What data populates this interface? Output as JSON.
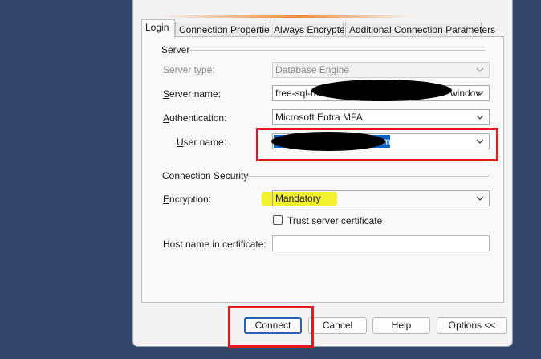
{
  "tabs": [
    {
      "label": "Login",
      "active": true
    },
    {
      "label": "Connection Properties",
      "active": false
    },
    {
      "label": "Always Encrypted",
      "active": false
    },
    {
      "label": "Additional Connection Parameters",
      "active": false
    }
  ],
  "server": {
    "section_title": "Server",
    "server_type_label": "Server type:",
    "server_type_value": "Database Engine",
    "server_name_label": "Server name:",
    "server_name_prefix": "free-sql-mi",
    "server_name_suffix": "windov",
    "authentication_label": "Authentication:",
    "authentication_value": "Microsoft Entra MFA",
    "user_name_label": "User name:",
    "user_name_suffix": "om"
  },
  "security": {
    "section_title": "Connection Security",
    "encryption_label": "Encryption:",
    "encryption_value": "Mandatory",
    "trust_label": "Trust server certificate",
    "trust_checked": false,
    "host_label": "Host name in certificate:",
    "host_value": ""
  },
  "buttons": {
    "connect": "Connect",
    "cancel": "Cancel",
    "help": "Help",
    "options": "Options <<"
  },
  "annotations": {
    "highlight_color": "#e11b1b",
    "marker_color": "#f2ef1c",
    "selection_color": "#0a64c8"
  }
}
